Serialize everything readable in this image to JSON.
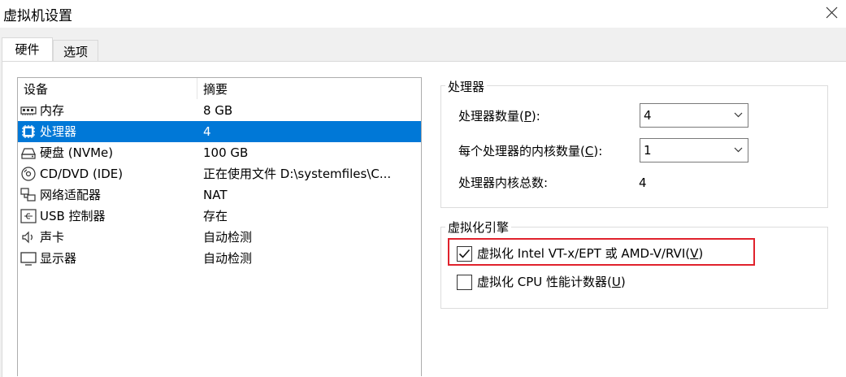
{
  "window": {
    "title": "虚拟机设置"
  },
  "tabs": [
    {
      "label": "硬件",
      "active": true
    },
    {
      "label": "选项",
      "active": false
    }
  ],
  "device_list": {
    "headers": {
      "device": "设备",
      "summary": "摘要"
    },
    "rows": [
      {
        "icon": "memory-icon",
        "device": "内存",
        "summary": "8 GB"
      },
      {
        "icon": "processor-icon",
        "device": "处理器",
        "summary": "4",
        "selected": true
      },
      {
        "icon": "hard-disk-icon",
        "device": "硬盘 (NVMe)",
        "summary": "100 GB"
      },
      {
        "icon": "cd-dvd-icon",
        "device": "CD/DVD (IDE)",
        "summary": "正在使用文件 D:\\systemfiles\\C..."
      },
      {
        "icon": "network-adapter-icon",
        "device": "网络适配器",
        "summary": "NAT"
      },
      {
        "icon": "usb-icon",
        "device": "USB 控制器",
        "summary": "存在"
      },
      {
        "icon": "sound-card-icon",
        "device": "声卡",
        "summary": "自动检测"
      },
      {
        "icon": "display-icon",
        "device": "显示器",
        "summary": "自动检测"
      }
    ]
  },
  "processor_group": {
    "legend": "处理器",
    "processors_label": {
      "prefix": "处理器数量(",
      "key": "P",
      "suffix": "):"
    },
    "processors_value": "4",
    "cores_label": {
      "prefix": "每个处理器的内核数量(",
      "key": "C",
      "suffix": "):"
    },
    "cores_value": "1",
    "total_label": "处理器内核总数:",
    "total_value": "4"
  },
  "virtualization_group": {
    "legend": "虚拟化引擎",
    "vtx": {
      "prefix": "虚拟化 Intel VT-x/EPT 或 AMD-V/RVI(",
      "key": "V",
      "suffix": ")",
      "checked": true
    },
    "cpu_counters": {
      "prefix": "虚拟化 CPU 性能计数器(",
      "key": "U",
      "suffix": ")",
      "checked": false
    }
  },
  "colors": {
    "selection": "#0078d7",
    "highlight_border": "#e0222c"
  }
}
